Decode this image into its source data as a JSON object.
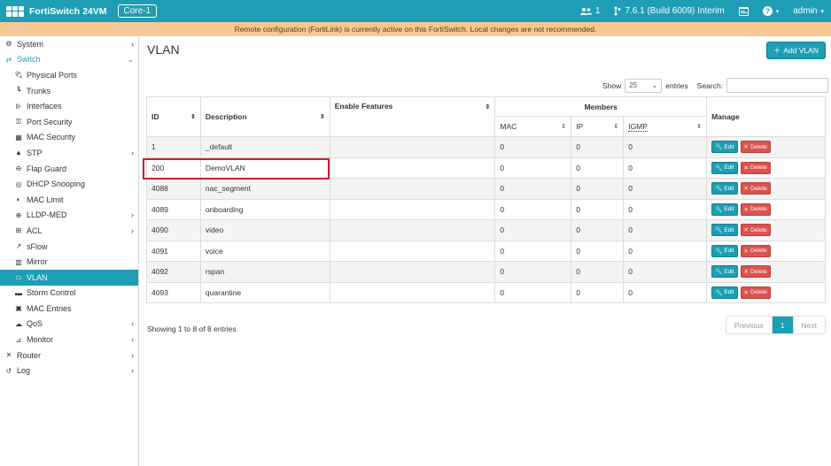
{
  "header": {
    "app_title": "FortiSwitch 24VM",
    "device": "Core-1",
    "users_count": "1",
    "version": "7.6.1 (Build 6009) Interim",
    "user": "admin"
  },
  "banner": "Remote configuration (FortiLink) is currently active on this FortiSwitch. Local changes are not recommended.",
  "sidebar": {
    "items": [
      {
        "label": "System",
        "icon": "gear-icon",
        "level": 0,
        "chevron": "›"
      },
      {
        "label": "Switch",
        "icon": "switch-icon",
        "level": 0,
        "chevron": "⌄"
      },
      {
        "label": "Physical Ports",
        "icon": "plug-icon",
        "level": 1
      },
      {
        "label": "Trunks",
        "icon": "trunk-icon",
        "level": 1
      },
      {
        "label": "Interfaces",
        "icon": "interfaces-icon",
        "level": 1
      },
      {
        "label": "Port Security",
        "icon": "key-icon",
        "level": 1
      },
      {
        "label": "MAC Security",
        "icon": "grid-icon",
        "level": 1
      },
      {
        "label": "STP",
        "icon": "tree-icon",
        "level": 1,
        "chevron": "›"
      },
      {
        "label": "Flap Guard",
        "icon": "link-icon",
        "level": 1
      },
      {
        "label": "DHCP Snooping",
        "icon": "dhcp-icon",
        "level": 1
      },
      {
        "label": "MAC Limit",
        "icon": "half-circle-icon",
        "level": 1
      },
      {
        "label": "LLDP-MED",
        "icon": "lldp-icon",
        "level": 1,
        "chevron": "›"
      },
      {
        "label": "ACL",
        "icon": "acl-icon",
        "level": 1,
        "chevron": "›"
      },
      {
        "label": "sFlow",
        "icon": "sflow-icon",
        "level": 1
      },
      {
        "label": "Mirror",
        "icon": "mirror-icon",
        "level": 1
      },
      {
        "label": "VLAN",
        "icon": "monitor-icon",
        "level": 1
      },
      {
        "label": "Storm Control",
        "icon": "storm-icon",
        "level": 1
      },
      {
        "label": "MAC Entries",
        "icon": "mac-entries-icon",
        "level": 1
      },
      {
        "label": "QoS",
        "icon": "qos-icon",
        "level": 1,
        "chevron": "›"
      },
      {
        "label": "Monitor",
        "icon": "chart-icon",
        "level": 1,
        "chevron": "›"
      },
      {
        "label": "Router",
        "icon": "router-icon",
        "level": 0,
        "chevron": "›"
      },
      {
        "label": "Log",
        "icon": "log-icon",
        "level": 0,
        "chevron": "›"
      }
    ]
  },
  "main": {
    "title": "VLAN",
    "add_label": "Add VLAN",
    "show_label": "Show",
    "page_length": "25",
    "entries_label": "entries",
    "search_label": "Search:",
    "columns": {
      "id": "ID",
      "description": "Description",
      "enable_features": "Enable Features",
      "members": "Members",
      "manage": "Manage",
      "mac": "MAC",
      "ip": "IP",
      "igmp": "IGMP"
    },
    "edit_label": "Edit",
    "delete_label": "Delete",
    "rows": [
      {
        "id": "1",
        "description": "_default",
        "features": "",
        "mac": "0",
        "ip": "0",
        "igmp": "0"
      },
      {
        "id": "200",
        "description": "DemoVLAN",
        "features": "",
        "mac": "0",
        "ip": "0",
        "igmp": "0"
      },
      {
        "id": "4088",
        "description": "nac_segment",
        "features": "",
        "mac": "0",
        "ip": "0",
        "igmp": "0"
      },
      {
        "id": "4089",
        "description": "onboarding",
        "features": "",
        "mac": "0",
        "ip": "0",
        "igmp": "0"
      },
      {
        "id": "4090",
        "description": "video",
        "features": "",
        "mac": "0",
        "ip": "0",
        "igmp": "0"
      },
      {
        "id": "4091",
        "description": "voice",
        "features": "",
        "mac": "0",
        "ip": "0",
        "igmp": "0"
      },
      {
        "id": "4092",
        "description": "rspan",
        "features": "",
        "mac": "0",
        "ip": "0",
        "igmp": "0"
      },
      {
        "id": "4093",
        "description": "quarantine",
        "features": "",
        "mac": "0",
        "ip": "0",
        "igmp": "0"
      }
    ],
    "info": "Showing 1 to 8 of 8 entries",
    "pager": {
      "previous": "Previous",
      "current": "1",
      "next": "Next"
    }
  },
  "colors": {
    "accent": "#1d9eb4",
    "danger": "#d9534f",
    "banner": "#f7c896",
    "highlight": "#c8202b"
  }
}
